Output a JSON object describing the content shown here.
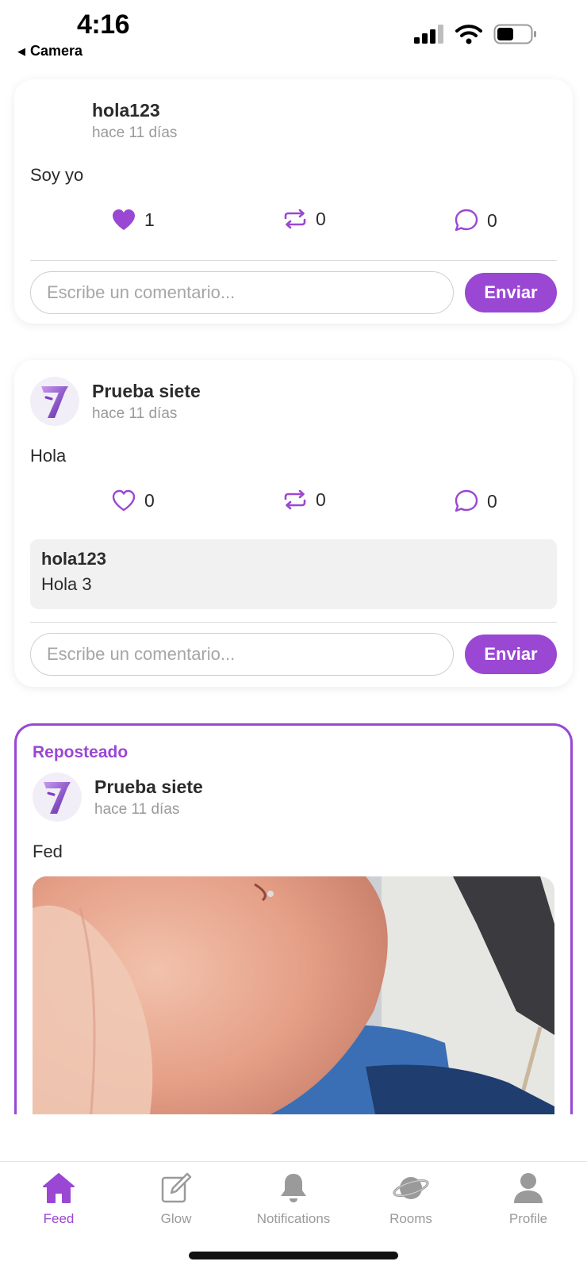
{
  "status_bar": {
    "time": "4:16",
    "back_label": "Camera"
  },
  "colors": {
    "accent": "#9a47d3",
    "text": "#2b2b2b",
    "muted": "#9a9a9a"
  },
  "posts": [
    {
      "author": "hola123",
      "time": "hace 11 días",
      "text": "Soy yo",
      "likes": "1",
      "liked": true,
      "reposts": "0",
      "comments": "0",
      "comment_placeholder": "Escribe un comentario...",
      "send_label": "Enviar"
    },
    {
      "author": "Prueba siete",
      "time": "hace 11 días",
      "text": "Hola",
      "likes": "0",
      "liked": false,
      "reposts": "0",
      "comments": "0",
      "reply": {
        "author": "hola123",
        "text": "Hola 3"
      },
      "comment_placeholder": "Escribe un comentario...",
      "send_label": "Enviar"
    },
    {
      "repost_label": "Reposteado",
      "author": "Prueba siete",
      "time": "hace 11 días",
      "text": "Fed"
    }
  ],
  "tabs": [
    {
      "label": "Feed",
      "icon": "home-icon",
      "active": true
    },
    {
      "label": "Glow",
      "icon": "compose-icon",
      "active": false
    },
    {
      "label": "Notifications",
      "icon": "bell-icon",
      "active": false
    },
    {
      "label": "Rooms",
      "icon": "planet-icon",
      "active": false
    },
    {
      "label": "Profile",
      "icon": "person-icon",
      "active": false
    }
  ]
}
